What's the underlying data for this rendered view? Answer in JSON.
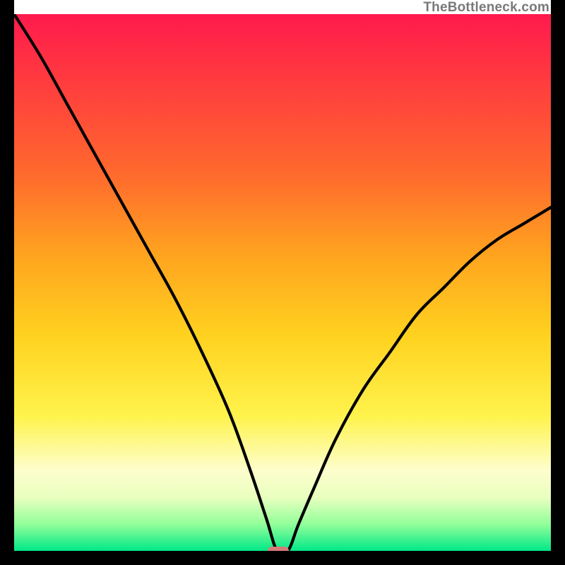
{
  "watermark": "TheBottleneck.com",
  "colors": {
    "frame": "#000000",
    "curve": "#000000",
    "notch": "#d77b7a",
    "gradient_top": "#ff1a4d",
    "gradient_bottom": "#00e888"
  },
  "chart_data": {
    "type": "line",
    "title": "",
    "xlabel": "",
    "ylabel": "",
    "xlim": [
      0,
      100
    ],
    "ylim": [
      0,
      100
    ],
    "grid": false,
    "legend": false,
    "notes": "Background is a vertical red→yellow→green gradient. The black curve shows bottleneck severity descending from top-left to a minimum near x≈49 then rising toward the right. A small rounded pink marker sits at the minimum on the x-axis.",
    "series": [
      {
        "name": "bottleneck-curve",
        "x": [
          0,
          5,
          10,
          15,
          20,
          25,
          30,
          35,
          40,
          44,
          47,
          49,
          51,
          53,
          56,
          60,
          65,
          70,
          75,
          80,
          85,
          90,
          95,
          100
        ],
        "values": [
          100,
          92,
          83,
          74,
          65,
          56,
          47,
          37,
          26,
          15,
          6,
          0,
          0,
          5,
          12,
          21,
          30,
          37,
          44,
          49,
          54,
          58,
          61,
          64
        ]
      }
    ],
    "marker": {
      "x_start": 47.2,
      "x_end": 51.2,
      "y": 0
    }
  }
}
